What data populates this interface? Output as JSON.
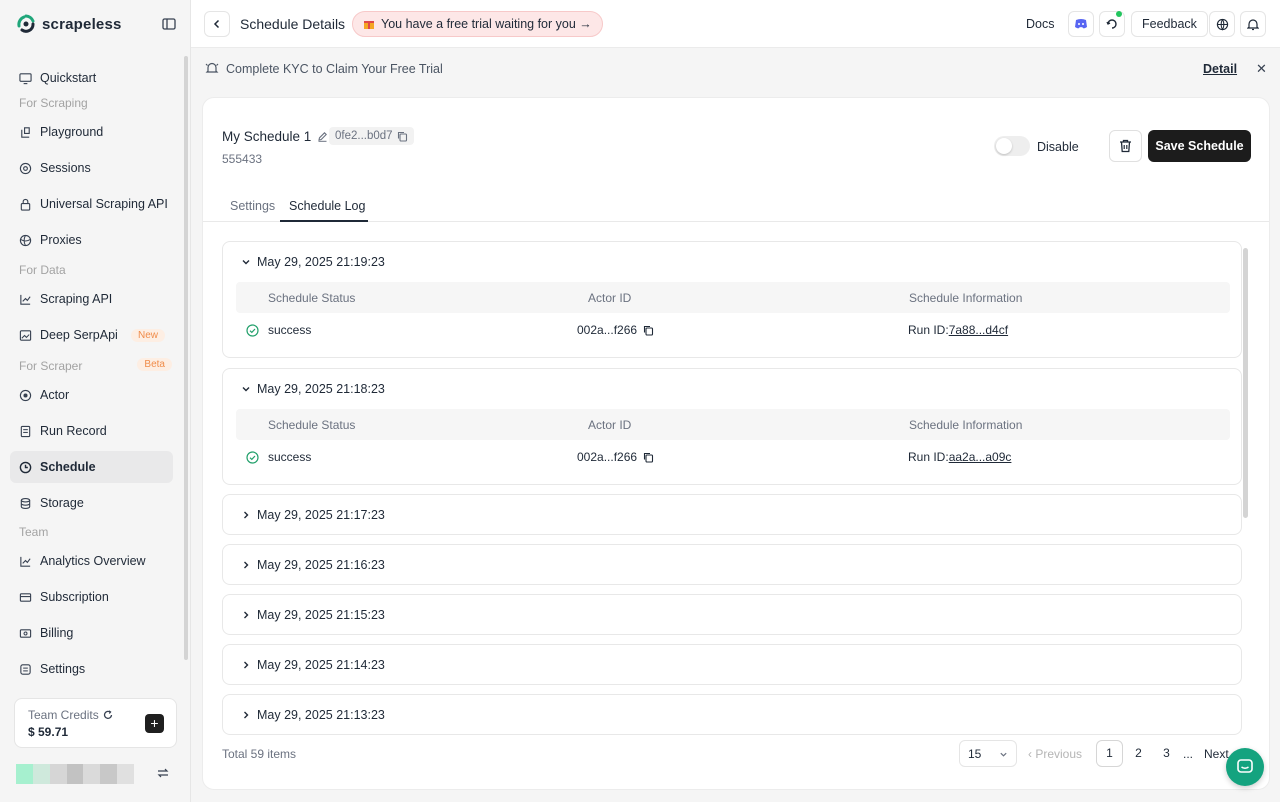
{
  "brand": {
    "name": "scrapeless"
  },
  "sidebar": {
    "items": [
      {
        "label": "Quickstart",
        "icon": "monitor-icon"
      },
      {
        "section": "For Scraping"
      },
      {
        "label": "Playground",
        "icon": "playground-icon"
      },
      {
        "label": "Sessions",
        "icon": "sessions-icon"
      },
      {
        "label": "Universal Scraping API",
        "icon": "lock-icon"
      },
      {
        "label": "Proxies",
        "icon": "globe-icon"
      },
      {
        "section": "For Data"
      },
      {
        "label": "Scraping API",
        "icon": "chart-icon"
      },
      {
        "label": "Deep SerpApi",
        "icon": "image-icon",
        "badge": "New"
      },
      {
        "section": "For Scraper",
        "badge": "Beta"
      },
      {
        "label": "Actor",
        "icon": "actor-icon"
      },
      {
        "label": "Run Record",
        "icon": "run-record-icon"
      },
      {
        "label": "Schedule",
        "icon": "schedule-icon",
        "active": true
      },
      {
        "label": "Storage",
        "icon": "storage-icon"
      },
      {
        "section": "Team"
      },
      {
        "label": "Analytics Overview",
        "icon": "analytics-icon"
      },
      {
        "label": "Subscription",
        "icon": "subscription-icon"
      },
      {
        "label": "Billing",
        "icon": "billing-icon"
      },
      {
        "label": "Settings",
        "icon": "settings-icon"
      }
    ],
    "credits": {
      "label": "Team Credits",
      "value": "$ 59.71"
    }
  },
  "topbar": {
    "title": "Schedule Details",
    "trial": "You have a free trial waiting for you →",
    "docs": "Docs",
    "feedback": "Feedback"
  },
  "kyc": {
    "text": "Complete KYC to Claim Your Free Trial",
    "detail": "Detail"
  },
  "schedule": {
    "name": "My Schedule 1",
    "id_short": "0fe2...b0d7",
    "sub": "555433",
    "toggle_label": "Disable",
    "save_label": "Save Schedule"
  },
  "tabs": [
    {
      "label": "Settings"
    },
    {
      "label": "Schedule Log",
      "active": true
    }
  ],
  "log": {
    "columns": [
      "Schedule Status",
      "Actor ID",
      "Schedule Information"
    ],
    "groups": [
      {
        "time": "May 29, 2025 21:19:23",
        "expanded": true,
        "status": "success",
        "actor_id": "002a...f266",
        "run_prefix": "Run ID:",
        "run_id": "7a88...d4cf"
      },
      {
        "time": "May 29, 2025 21:18:23",
        "expanded": true,
        "status": "success",
        "actor_id": "002a...f266",
        "run_prefix": "Run ID:",
        "run_id": "aa2a...a09c"
      },
      {
        "time": "May 29, 2025 21:17:23",
        "expanded": false
      },
      {
        "time": "May 29, 2025 21:16:23",
        "expanded": false
      },
      {
        "time": "May 29, 2025 21:15:23",
        "expanded": false
      },
      {
        "time": "May 29, 2025 21:14:23",
        "expanded": false
      },
      {
        "time": "May 29, 2025 21:13:23",
        "expanded": false
      }
    ]
  },
  "pagination": {
    "total": "Total 59 items",
    "page_size": "15",
    "prev": "Previous",
    "pages": [
      "1",
      "2",
      "3"
    ],
    "current": "1",
    "ellipsis": "...",
    "next": "Next"
  },
  "colors": {
    "accent": "#1c1c1c",
    "success": "#22a06b",
    "fab": "#14a37f"
  }
}
